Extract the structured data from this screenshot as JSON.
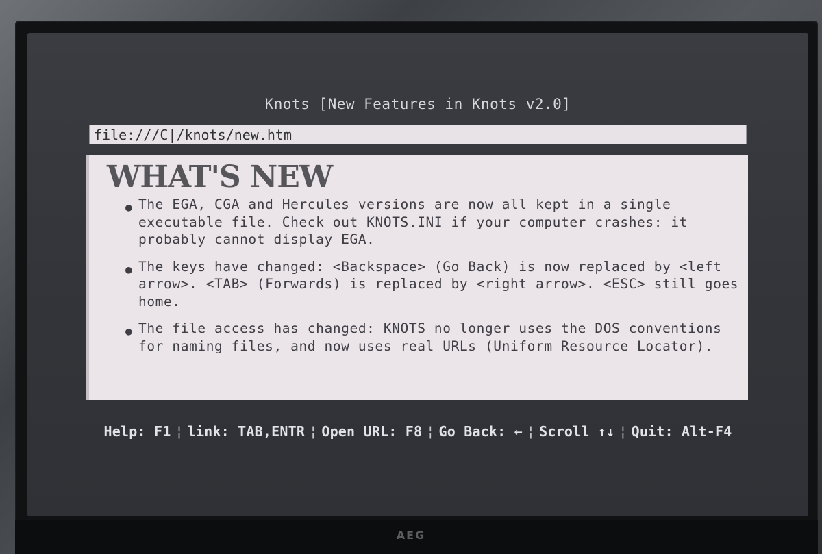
{
  "window": {
    "title": "Knots [New Features in Knots v2.0]"
  },
  "address_bar": {
    "url": "file:///C|/knots/new.htm"
  },
  "page": {
    "heading": "WHAT'S NEW",
    "bullet_icon": "bullet-dot",
    "bullets": [
      "The EGA, CGA and Hercules versions are now all kept in a single executable file. Check out KNOTS.INI if your computer crashes: it probably cannot display EGA.",
      "The keys have changed: <Backspace> (Go Back) is now replaced by <left arrow>. <TAB> (Forwards) is replaced by <right arrow>. <ESC> still goes home.",
      "The file access has changed: KNOTS no longer uses the DOS conventions for naming files, and now uses real URLs (Uniform Resource Locator)."
    ]
  },
  "status_bar": {
    "items": [
      "Help: F1",
      "link: TAB,ENTR",
      "Open URL: F8",
      "Go Back: ←",
      "Scroll ↑↓",
      "Quit: Alt-F4"
    ],
    "separator": "¦"
  },
  "monitor": {
    "brand": "AEG"
  },
  "colors": {
    "screen_bg": "#35373c",
    "content_bg": "#ebe5ea",
    "content_text": "#3e3e44",
    "status_text": "#e2e3e6"
  }
}
